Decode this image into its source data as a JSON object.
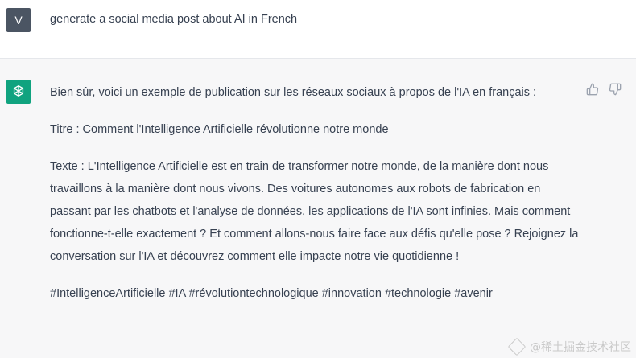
{
  "user_message": {
    "avatar_letter": "V",
    "text": "generate a social media post about AI in French"
  },
  "assistant_message": {
    "avatar_icon": "openai-logo-icon",
    "paragraphs": [
      "Bien sûr, voici un exemple de publication sur les réseaux sociaux à propos de l'IA en français :",
      "Titre : Comment l'Intelligence Artificielle révolutionne notre monde",
      "Texte : L'Intelligence Artificielle est en train de transformer notre monde, de la manière dont nous travaillons à la manière dont nous vivons. Des voitures autonomes aux robots de fabrication en passant par les chatbots et l'analyse de données, les applications de l'IA sont infinies. Mais comment fonctionne-t-elle exactement ? Et comment allons-nous faire face aux défis qu'elle pose ? Rejoignez la conversation sur l'IA et découvrez comment elle impacte notre vie quotidienne !",
      "#IntelligenceArtificielle #IA #révolutiontechnologique #innovation #technologie #avenir"
    ],
    "feedback": {
      "thumbs_up_icon": "thumbs-up-icon",
      "thumbs_down_icon": "thumbs-down-icon"
    }
  },
  "watermark": {
    "text": "@稀土掘金技术社区"
  },
  "colors": {
    "user_avatar_bg": "#4b5563",
    "assistant_avatar_bg": "#10a37f",
    "assistant_row_bg": "#f7f7f8"
  }
}
